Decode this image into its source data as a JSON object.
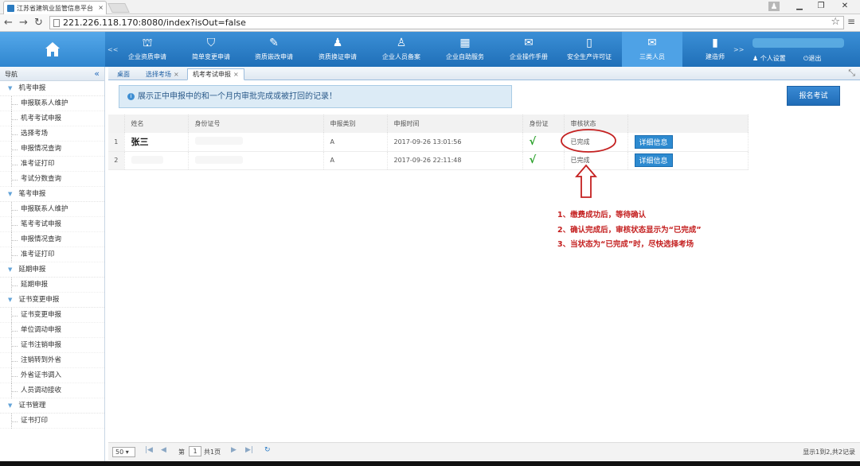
{
  "browser": {
    "tab_title": "江苏省建筑业监管信息平台",
    "tab_close": "×",
    "url": "221.226.118.170:8080/index?isOut=false",
    "window_controls": [
      "▁",
      "❐",
      "✕"
    ]
  },
  "topnav": {
    "items": [
      {
        "label": "企业资质申请",
        "icon": "⛫"
      },
      {
        "label": "简单变更申请",
        "icon": "⛉"
      },
      {
        "label": "资质嵌改申请",
        "icon": "✎"
      },
      {
        "label": "资质换证申请",
        "icon": "♟"
      },
      {
        "label": "企业人员备案",
        "icon": "♙"
      },
      {
        "label": "企业自助服务",
        "icon": "▦"
      },
      {
        "label": "企业操作手册",
        "icon": "✉"
      },
      {
        "label": "安全生产许可证",
        "icon": "▯"
      },
      {
        "label": "三类人员",
        "icon": "✉"
      },
      {
        "label": "建造师",
        "icon": "▮"
      }
    ],
    "arrow_left": "<<",
    "arrow_right": ">>",
    "user_settings": "个人设置",
    "logout": "退出"
  },
  "sidebar": {
    "title": "导航",
    "collapse": "«",
    "groups": [
      {
        "label": "机考申报",
        "items": [
          "申报联系人维护",
          "机考考试申报",
          "选择考场",
          "申报情况查询",
          "准考证打印",
          "考试分数查询"
        ]
      },
      {
        "label": "笔考申报",
        "items": [
          "申报联系人维护",
          "笔考考试申报",
          "申报情况查询",
          "准考证打印"
        ]
      },
      {
        "label": "延期申报",
        "items": [
          "延期申报"
        ]
      },
      {
        "label": "证书变更申报",
        "items": [
          "证书变更申报",
          "单位调动申报",
          "证书注销申报",
          "注销转到外省",
          "外省证书调入",
          "人员调动接收"
        ]
      },
      {
        "label": "证书管理",
        "items": [
          "证书打印"
        ]
      }
    ]
  },
  "page_tabs": [
    {
      "label": "桌面",
      "closable": false
    },
    {
      "label": "选择考场",
      "closable": true
    },
    {
      "label": "机考考试申报",
      "closable": true
    }
  ],
  "tab_close": "×",
  "notice": "展示正中申报中的和一个月内审批完成或被打回的记录！",
  "apply_button": "报名考试",
  "table": {
    "headers": [
      "姓名",
      "身份证号",
      "申报类别",
      "申报时间",
      "身份证",
      "审核状态",
      ""
    ],
    "rows": [
      {
        "no": "1",
        "name": "张三",
        "category": "A",
        "time": "2017-09-26 13:01:56",
        "idcard": "√",
        "status": "已完成",
        "action": "详细信息"
      },
      {
        "no": "2",
        "name": "",
        "category": "A",
        "time": "2017-09-26 22:11:48",
        "idcard": "√",
        "status": "已完成",
        "action": "详细信息"
      }
    ]
  },
  "annotations": [
    "1、缴费成功后，等待确认",
    "2、确认完成后，审核状态显示为“已完成”",
    "3、当状态为“已完成”时，尽快选择考场"
  ],
  "pager": {
    "page_size": "50",
    "page_prefix": "第",
    "page": "1",
    "page_suffix": "共1页",
    "info": "显示1到2,共2记录"
  },
  "colors": {
    "accent": "#1f6fb8",
    "annotation": "#c42020",
    "check": "#28a028"
  }
}
